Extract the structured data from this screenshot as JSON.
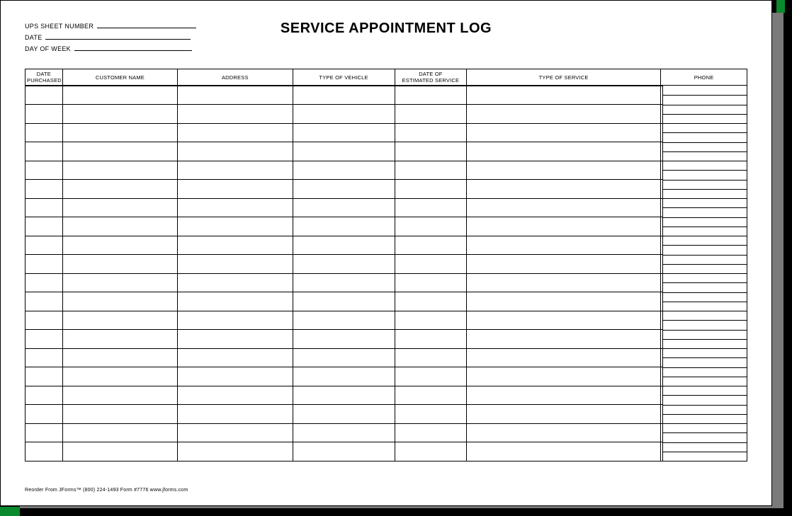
{
  "title": "SERVICE APPOINTMENT LOG",
  "meta": {
    "ups_label": "UPS SHEET NUMBER",
    "date_label": "DATE",
    "dow_label": "DAY OF WEEK"
  },
  "columns": {
    "date_purchased": "DATE\nPURCHASED",
    "customer_name": "CUSTOMER NAME",
    "address": "ADDRESS",
    "type_of_vehicle": "TYPE OF VEHICLE",
    "date_of_estimated_service": "DATE OF\nESTIMATED SERVICE",
    "type_of_service": "TYPE OF SERVICE",
    "phone": "PHONE"
  },
  "row_count": 20,
  "phone_sub_rows": 40,
  "footer": "Reorder From JForms™ (800) 224-1493 Form #7776 www.jforms.com"
}
